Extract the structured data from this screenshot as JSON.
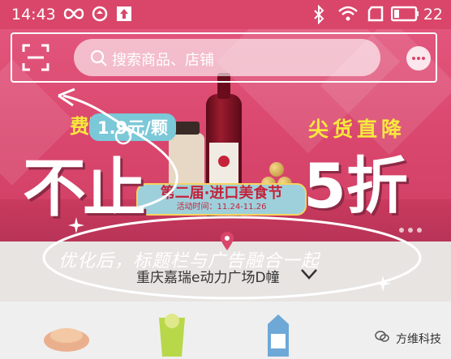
{
  "statusbar": {
    "time": "14:43",
    "battery": "22"
  },
  "header": {
    "search_placeholder": "搜索商品、店铺"
  },
  "banner": {
    "brand": "费列罗",
    "price": "1.9元/颗",
    "headline_left": "不止",
    "headline_right": "5折",
    "tagline": "尖货直降",
    "event_title": "第二届·进口美食节",
    "event_dates": "活动时间：11.24-11.26"
  },
  "location": {
    "label": "重庆嘉瑞e动力广场D幢"
  },
  "annotation": {
    "text": "优化后，标题栏与广告融合一起"
  },
  "watermark": {
    "text": "方维科技"
  },
  "colors": {
    "accent": "#d9466a",
    "ribbon": "#9ed0dc",
    "highlight": "#f7e93c"
  }
}
